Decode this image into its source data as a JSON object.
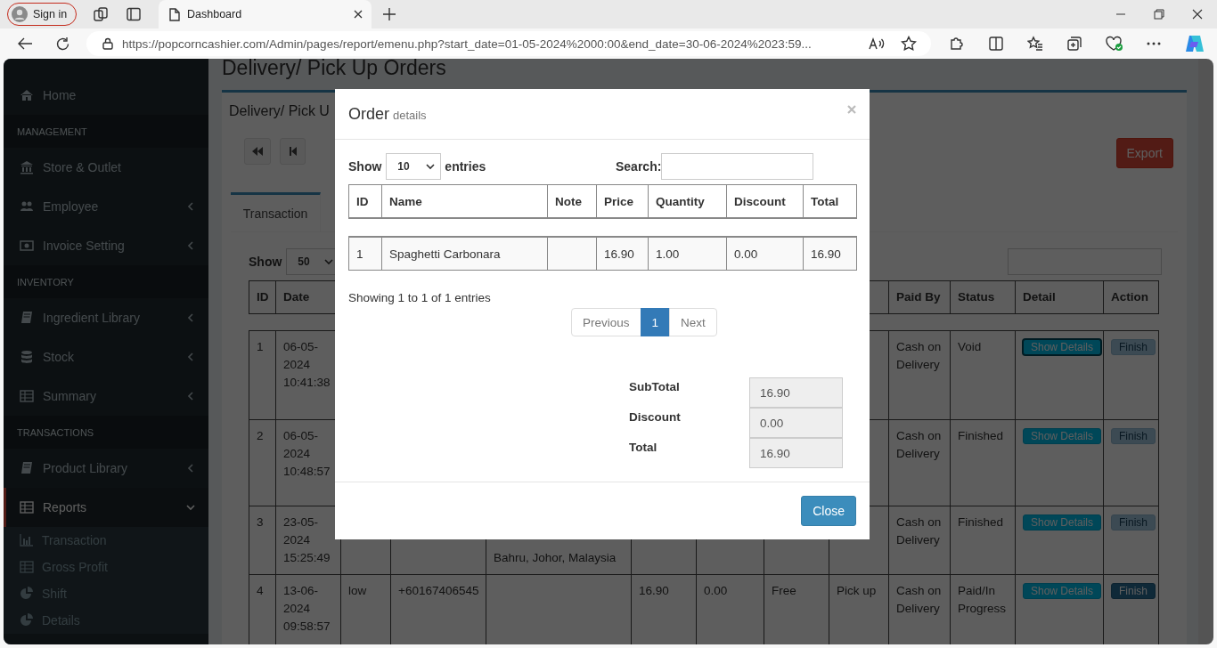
{
  "browser": {
    "sign_in": "Sign in",
    "tabs": [
      {
        "title": "Dashboard",
        "selected": true
      }
    ],
    "url": "https://popcorncashier.com/Admin/pages/report/emenu.php?start_date=01-05-2024%2000:00&end_date=30-06-2024%2023:59..."
  },
  "sidebar": {
    "items": [
      {
        "kind": "link",
        "label": "Home",
        "selected": false
      },
      {
        "kind": "header",
        "label": "MANAGEMENT"
      },
      {
        "kind": "link",
        "label": "Store & Outlet",
        "selected": false
      },
      {
        "kind": "menu",
        "label": "Employee",
        "selected": false,
        "expanded": false
      },
      {
        "kind": "menu",
        "label": "Invoice Setting",
        "selected": false,
        "expanded": false
      },
      {
        "kind": "header",
        "label": "INVENTORY"
      },
      {
        "kind": "menu",
        "label": "Ingredient Library",
        "selected": false,
        "expanded": false
      },
      {
        "kind": "menu",
        "label": "Stock",
        "selected": false,
        "expanded": false
      },
      {
        "kind": "menu",
        "label": "Summary",
        "selected": false,
        "expanded": false
      },
      {
        "kind": "header",
        "label": "TRANSACTIONS"
      },
      {
        "kind": "menu",
        "label": "Product Library",
        "selected": false,
        "expanded": false
      },
      {
        "kind": "menu",
        "label": "Reports",
        "selected": true,
        "expanded": true,
        "children": [
          {
            "label": "Transaction",
            "selected": false
          },
          {
            "label": "Gross Profit",
            "selected": false
          },
          {
            "label": "Shift",
            "selected": false
          },
          {
            "label": "Details",
            "selected": false
          }
        ]
      }
    ]
  },
  "page": {
    "heading": "Delivery/ Pick Up Orders",
    "box_title": "Delivery/ Pick U",
    "export": "Export",
    "tabs": [
      {
        "label": "Transaction",
        "selected": true
      }
    ],
    "show_label": "Show",
    "page_size": "50",
    "table": {
      "columns": {
        "id": "ID",
        "date": "Date",
        "paid_by": "Paid By",
        "status": "Status",
        "detail": "Detail",
        "action": "Action"
      },
      "rows": [
        {
          "id": "1",
          "date": "06-05-2024 10:41:38",
          "paid_by": "Cash on Delivery",
          "status": "Void",
          "detail": {
            "label": "Show Details",
            "focused": true
          },
          "action": {
            "label": "Finish",
            "disabled": true
          }
        },
        {
          "id": "2",
          "date": "06-05-2024 10:48:57",
          "paid_by": "Cash on Delivery",
          "status": "Finished",
          "detail": {
            "label": "Show Details",
            "focused": false
          },
          "action": {
            "label": "Finish",
            "disabled": true
          }
        },
        {
          "id": "3",
          "date": "23-05-2024 15:25:49",
          "column_5": "Bahru, Johor, Malaysia",
          "paid_by": "Cash on Delivery",
          "status": "Finished",
          "detail": {
            "label": "Show Details",
            "focused": false
          },
          "action": {
            "label": "Finish",
            "disabled": true
          }
        },
        {
          "id": "4",
          "date": "13-06-2024 09:58:57",
          "column_3": "low",
          "column_4": "+60167406545",
          "column_6": "16.90",
          "column_7": "0.00",
          "column_8": "Free",
          "column_9": "Pick up",
          "paid_by": "Cash on Delivery",
          "status": "Paid/In Progress",
          "detail": {
            "label": "Show Details",
            "focused": false
          },
          "action": {
            "label": "Finish",
            "disabled": false
          }
        }
      ]
    }
  },
  "modal": {
    "title": "Order",
    "subtitle": "details",
    "show_label": "Show",
    "page_size": "10",
    "entries_label": "entries",
    "search_label": "Search:",
    "table": {
      "columns": {
        "id": "ID",
        "name": "Name",
        "note": "Note",
        "price": "Price",
        "quantity": "Quantity",
        "discount": "Discount",
        "total": "Total"
      },
      "rows": [
        {
          "id": "1",
          "name": "Spaghetti Carbonara",
          "price": "16.90",
          "quantity": "1.00",
          "discount": "0.00",
          "total": "16.90"
        }
      ]
    },
    "info": "Showing 1 to 1 of 1 entries",
    "pages": [
      {
        "label": "Previous",
        "selected": false
      },
      {
        "label": "1",
        "selected": true
      },
      {
        "label": "Next",
        "selected": false
      }
    ],
    "totals": [
      {
        "label": "SubTotal",
        "value": "16.90"
      },
      {
        "label": "Discount",
        "value": "0.00"
      },
      {
        "label": "Total",
        "value": "16.90"
      }
    ],
    "close": "Close"
  }
}
